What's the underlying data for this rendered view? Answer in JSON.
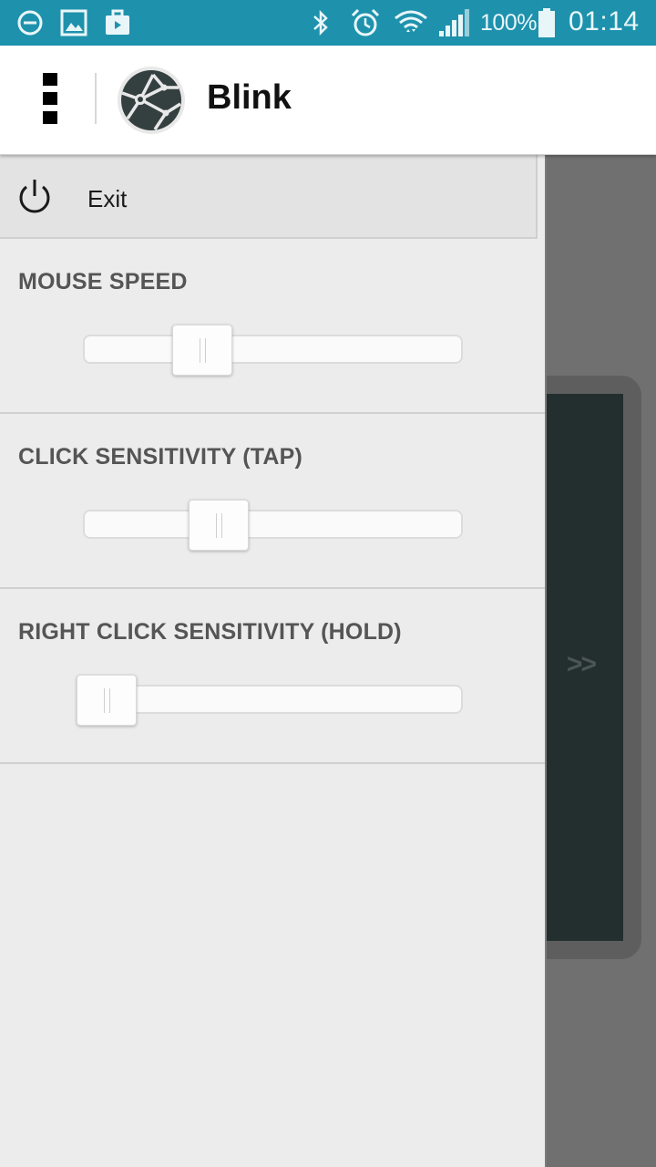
{
  "status_bar": {
    "icons_left": [
      "do-not-disturb-icon",
      "image-icon",
      "briefcase-icon"
    ],
    "icons_right": [
      "bluetooth-icon",
      "alarm-icon",
      "wifi-icon",
      "signal-icon",
      "battery-icon"
    ],
    "battery_percent": "100%",
    "time": "01:14",
    "color": "#1e92ad"
  },
  "app_bar": {
    "title": "Blink",
    "menu_icon": "overflow-menu-icon",
    "logo_icon": "blink-logo-icon"
  },
  "drawer": {
    "exit": {
      "label": "Exit",
      "icon": "power-icon"
    },
    "sections": [
      {
        "title": "MOUSE SPEED",
        "value": 0.29
      },
      {
        "title": "CLICK SENSITIVITY (TAP)",
        "value": 0.34
      },
      {
        "title": "RIGHT CLICK SENSITIVITY (HOLD)",
        "value": 0.0
      }
    ]
  },
  "touchpad": {
    "expand_label": ">>"
  }
}
